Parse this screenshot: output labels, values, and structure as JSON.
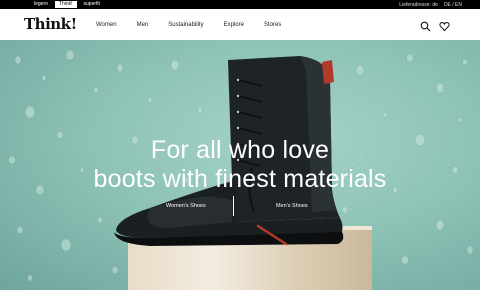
{
  "topbar": {
    "brand_tabs": [
      {
        "label": "legero",
        "active": false
      },
      {
        "label": "Think!",
        "active": true
      },
      {
        "label": "superfit",
        "active": false
      }
    ],
    "links": [
      "Lieferadresse: de",
      "DE / EN"
    ]
  },
  "header": {
    "logo": "Think!",
    "nav": [
      "Women",
      "Men",
      "Sustainability",
      "Explore",
      "Stores"
    ]
  },
  "hero": {
    "headline_line1": "For all who love",
    "headline_line2": "boots with finest materials",
    "cta_women": "Women's Shoes",
    "cta_men": "Men's Shoes"
  },
  "colors": {
    "hero_bg": "#8fc3b8",
    "topbar_bg": "#000000",
    "text_white": "#ffffff"
  },
  "icons": [
    "search-icon",
    "heart-icon"
  ]
}
